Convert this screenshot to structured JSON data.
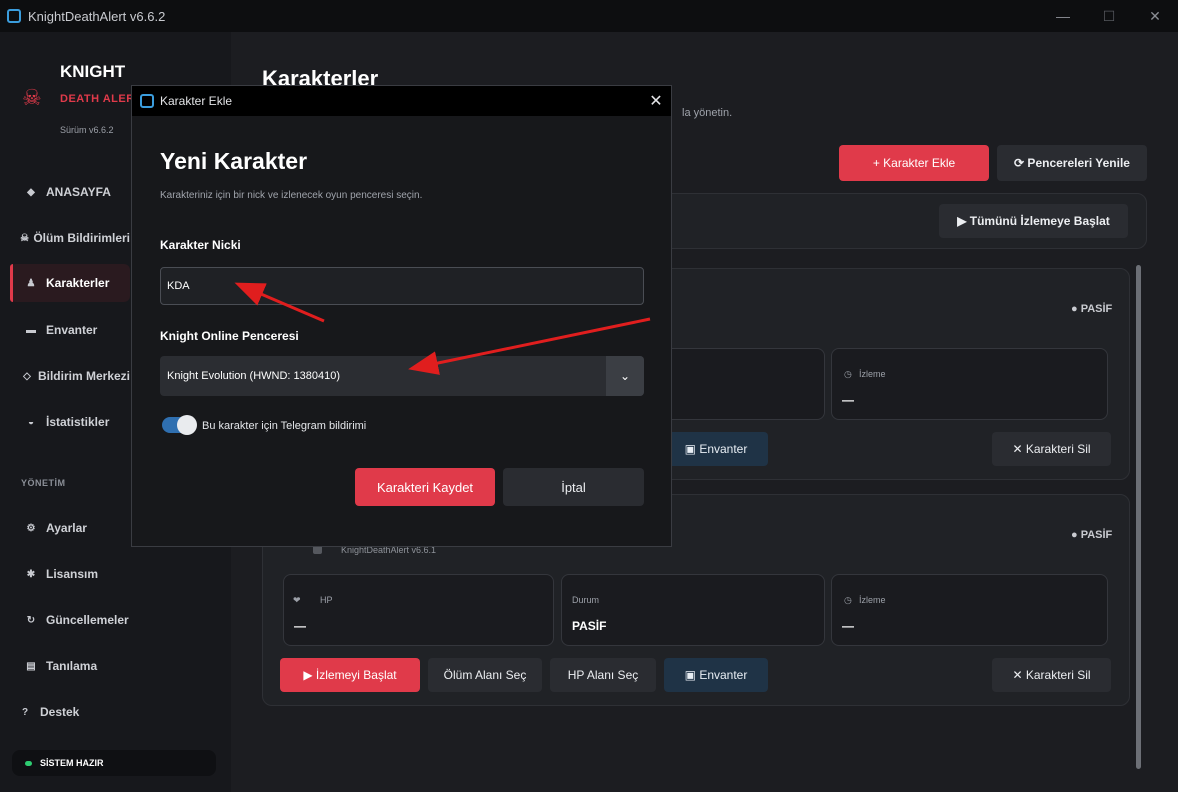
{
  "window": {
    "title": "KnightDeathAlert v6.6.2",
    "minimize": "—",
    "maximize": "☐",
    "close": "✕"
  },
  "sidebar": {
    "brand_title": "KNIGHT",
    "brand_subtitle": "DEATH ALERT",
    "version": "Sürüm v6.6.2",
    "items": [
      {
        "label": "ANASAYFA",
        "icon": "diamond-icon"
      },
      {
        "label": "Ölüm Bildirimleri",
        "icon": "skull-icon"
      },
      {
        "label": "Karakterler",
        "icon": "person-icon"
      },
      {
        "label": "Envanter",
        "icon": "box-icon"
      },
      {
        "label": "Bildirim Merkezi",
        "icon": "diamond-icon"
      },
      {
        "label": "İstatistikler",
        "icon": "stats-icon"
      }
    ],
    "section_label": "YÖNETİM",
    "admin_items": [
      {
        "label": "Ayarlar",
        "icon": "gear-icon"
      },
      {
        "label": "Lisansım",
        "icon": "badge-icon"
      },
      {
        "label": "Güncellemeler",
        "icon": "refresh-icon"
      },
      {
        "label": "Tanılama",
        "icon": "document-icon"
      },
      {
        "label": "Destek",
        "icon": "question-icon"
      }
    ],
    "status": "SİSTEM HAZIR"
  },
  "main": {
    "title": "Karakterler",
    "subtitle": "la yönetin.",
    "add_button": "+ Karakter Ekle",
    "refresh_button": "⟳ Pencereleri Yenile",
    "start_all_button": "▶ Tümünü İzlemeye Başlat",
    "characters": [
      {
        "status_badge": "● PASİF",
        "monitor_label": "İzleme",
        "monitor_value": "—",
        "inventory_button": "▣ Envanter",
        "delete_button": "✕ Karakteri Sil"
      },
      {
        "window_name": "KnightDeathAlert v6.6.1",
        "status_badge": "● PASİF",
        "hp_label": "HP",
        "hp_value": "—",
        "state_label": "Durum",
        "state_value": "PASİF",
        "monitor_label": "İzleme",
        "monitor_value": "—",
        "start_button": "▶ İzlemeyi Başlat",
        "death_area_button": "Ölüm Alanı Seç",
        "hp_area_button": "HP Alanı Seç",
        "inventory_button": "▣ Envanter",
        "delete_button": "✕ Karakteri Sil"
      }
    ]
  },
  "modal": {
    "window_title": "Karakter Ekle",
    "heading": "Yeni Karakter",
    "description": "Karakteriniz için bir nick ve izlenecek oyun penceresi seçin.",
    "nick_label": "Karakter Nicki",
    "nick_value": "KDA",
    "window_label": "Knight Online Penceresi",
    "window_value": "Knight Evolution (HWND: 1380410)",
    "telegram_toggle_label": "Bu karakter için Telegram bildirimi",
    "telegram_enabled": true,
    "save_button": "Karakteri Kaydet",
    "cancel_button": "İptal"
  },
  "colors": {
    "accent": "#e03a4a",
    "toggle": "#2f6fb0",
    "annotation_arrow": "#e01e1e"
  }
}
